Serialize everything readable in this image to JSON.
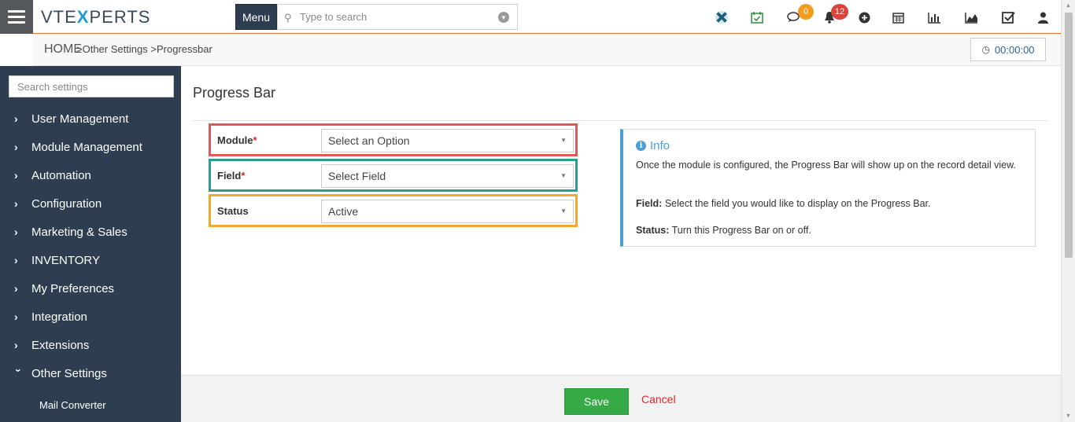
{
  "app": {
    "logo_text_pre": "VTE",
    "logo_text_x": "X",
    "logo_text_post": "PERTS"
  },
  "header": {
    "menu_label": "Menu",
    "search_placeholder": "Type to search",
    "chat_badge": "0",
    "notifications_badge": "12",
    "icons": [
      "vtx-logo-icon",
      "calendar-check-icon",
      "chat-icon",
      "bell-icon",
      "plus-circle-icon",
      "calendar-icon",
      "bar-chart-icon",
      "area-chart-icon",
      "checkbox-icon",
      "user-icon"
    ]
  },
  "breadcrumb": {
    "home": "HOME",
    "crumb1": "Other Settings",
    "crumb2": "Progressbar",
    "timer": "00:00:00"
  },
  "sidebar": {
    "search_placeholder": "Search settings",
    "items": [
      {
        "label": "User Management"
      },
      {
        "label": "Module Management"
      },
      {
        "label": "Automation"
      },
      {
        "label": "Configuration"
      },
      {
        "label": "Marketing & Sales"
      },
      {
        "label": "INVENTORY"
      },
      {
        "label": "My Preferences"
      },
      {
        "label": "Integration"
      },
      {
        "label": "Extensions"
      },
      {
        "label": "Other Settings"
      }
    ],
    "sub_item": "Mail Converter"
  },
  "main": {
    "title": "Progress Bar",
    "fields": [
      {
        "label": "Module",
        "required": "*",
        "value": "Select an Option",
        "border_color": "#e05a5a"
      },
      {
        "label": "Field",
        "required": "*",
        "value": "Select Field",
        "border_color": "#2a9d8f"
      },
      {
        "label": "Status",
        "required": "",
        "value": "Active",
        "border_color": "#f0a830"
      }
    ],
    "info": {
      "title": "Info",
      "line1": "Once the module is configured, the Progress Bar will show up on the record detail view.",
      "field_label": "Field:",
      "field_text": "Select the field you would like to display on the Progress Bar.",
      "status_label": "Status:",
      "status_text": "Turn this Progress Bar on or off."
    }
  },
  "footer": {
    "save_label": "Save",
    "cancel_label": "Cancel"
  },
  "colors": {
    "sidebar_bg": "#2e3e50",
    "accent_orange": "#e8702a",
    "save_green": "#35aa47",
    "cancel_red": "#d62b2b",
    "info_blue": "#4a9fd4"
  }
}
